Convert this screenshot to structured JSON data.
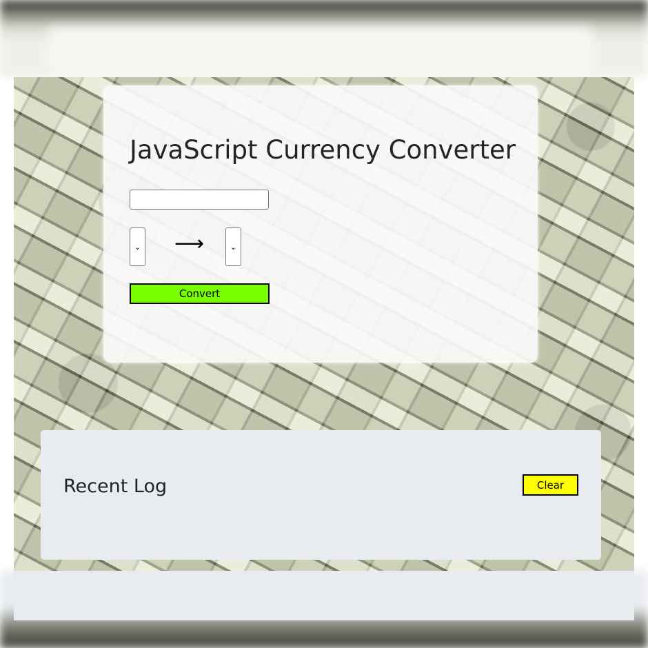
{
  "converter": {
    "title": "JavaScript Currency Converter",
    "amount_value": "",
    "amount_placeholder": "",
    "from_currency": "",
    "to_currency": "",
    "arrow_glyph": "⟶",
    "convert_label": "Convert"
  },
  "log": {
    "title": "Recent Log",
    "clear_label": "Clear",
    "entries": []
  },
  "icons": {
    "select_chevron": "chevron-down-icon",
    "arrow": "arrow-right-icon"
  },
  "colors": {
    "convert_button": "#77ff00",
    "clear_button": "#ffff00",
    "log_panel": "#e9ecef",
    "card": "#fafafa",
    "text": "#212529"
  }
}
